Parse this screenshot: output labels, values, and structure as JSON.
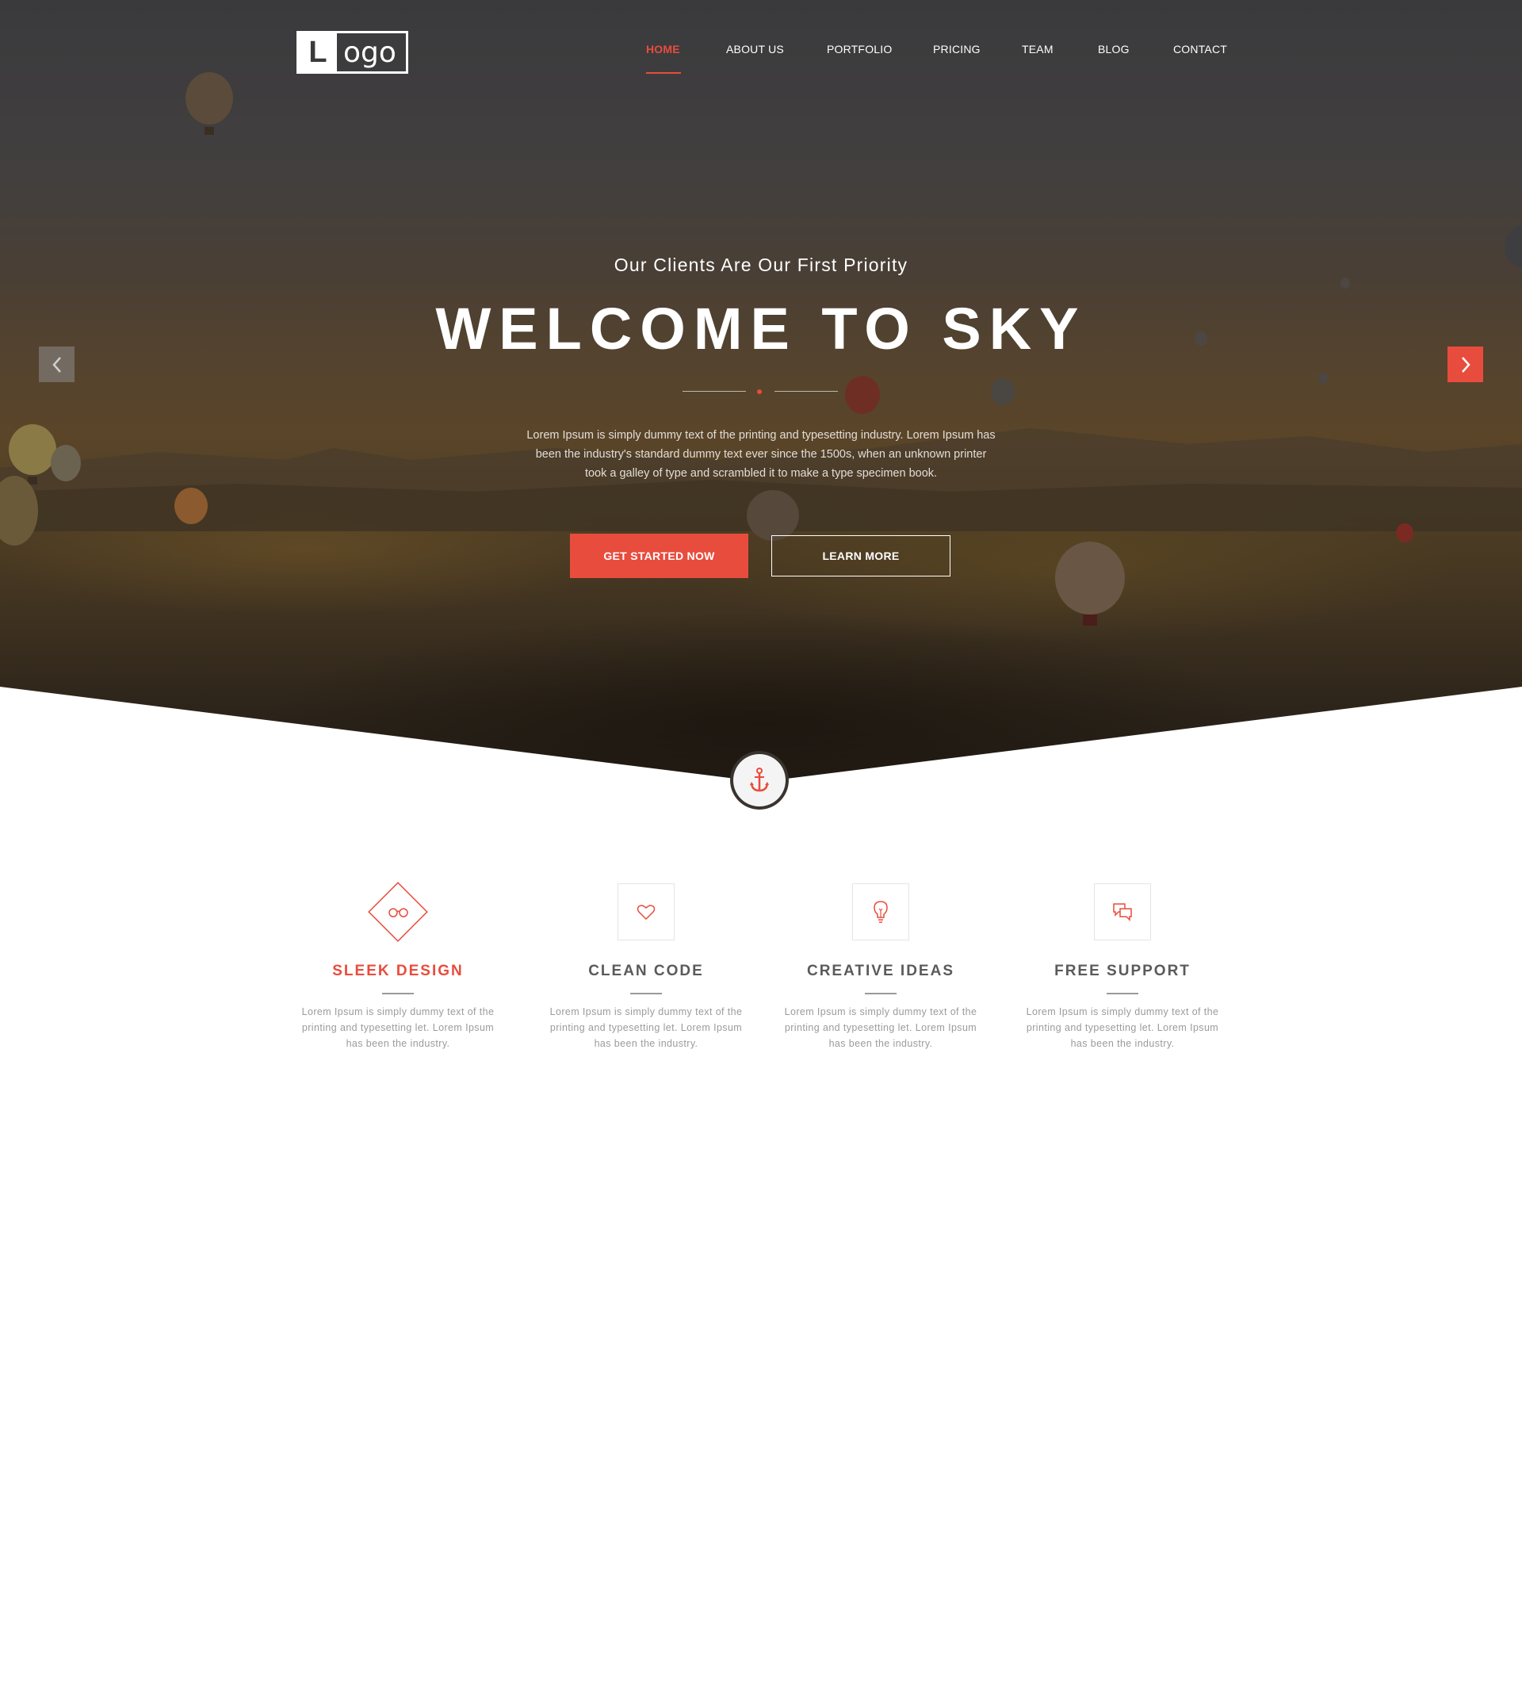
{
  "header": {
    "logo": {
      "letter": "L",
      "rest": "ogo"
    },
    "nav": [
      {
        "label": "HOME",
        "active": true
      },
      {
        "label": "ABOUT US",
        "active": false
      },
      {
        "label": "PORTFOLIO",
        "active": false
      },
      {
        "label": "PRICING",
        "active": false
      },
      {
        "label": "TEAM",
        "active": false
      },
      {
        "label": "BLOG",
        "active": false
      },
      {
        "label": "CONTACT",
        "active": false
      }
    ]
  },
  "hero": {
    "subtitle": "Our Clients Are Our First Priority",
    "title": "WELCOME TO SKY",
    "text": "Lorem Ipsum is simply dummy text of the printing and typesetting industry. Lorem Ipsum has been the industry's standard dummy text ever since the 1500s, when an unknown printer took a galley of type and scrambled it to make a type specimen book.",
    "primary_button": "GET STARTED NOW",
    "secondary_button": "LEARN MORE",
    "prev_icon": "chevron-left-icon",
    "next_icon": "chevron-right-icon",
    "badge_icon": "anchor-icon"
  },
  "features": [
    {
      "title": "SLEEK DESIGN",
      "icon": "glasses-icon",
      "desc": "Lorem Ipsum is simply dummy text of the printing and typesetting let. Lorem Ipsum has been the industry."
    },
    {
      "title": "CLEAN CODE",
      "icon": "heart-icon",
      "desc": "Lorem Ipsum is simply dummy text of the printing and typesetting let. Lorem Ipsum has been the industry."
    },
    {
      "title": "CREATIVE IDEAS",
      "icon": "lightbulb-icon",
      "desc": "Lorem Ipsum is simply dummy text of the printing and typesetting let. Lorem Ipsum has been the industry."
    },
    {
      "title": "FREE SUPPORT",
      "icon": "chat-icon",
      "desc": "Lorem Ipsum is simply dummy text of the printing and typesetting let. Lorem Ipsum has been the industry."
    }
  ],
  "colors": {
    "accent": "#e84c3d",
    "text_dark": "#5a5a5a",
    "text_muted": "#9b9b9b"
  }
}
